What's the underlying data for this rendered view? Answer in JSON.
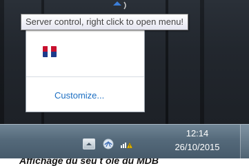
{
  "tooltip": {
    "text": "Server control, right click to open menu!"
  },
  "overflow_panel": {
    "app_icon": "server-control-app-icon",
    "customize_label": "Customize..."
  },
  "taskbar": {
    "icons": [
      "chevron-up-icon",
      "network-globe-icon",
      "signal-warning-icon"
    ],
    "clock": {
      "time": "12:14",
      "date": "26/10/2015"
    }
  },
  "caption": {
    "text": "Affichage du seu t ôle du MDB"
  }
}
